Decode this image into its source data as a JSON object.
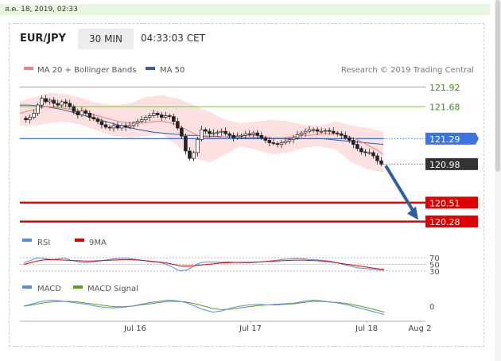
{
  "timestamp": "ส.ค. 18, 2019, 02:33",
  "header": {
    "symbol": "EUR/JPY",
    "timeframe": "30 MIN",
    "time": "04:33:03 CET"
  },
  "legend": {
    "ma20_bb": "MA 20 + Bollinger Bands",
    "ma50": "MA 50",
    "credit": "Research © 2019 Trading Central"
  },
  "colors": {
    "resistance": "#7ec341",
    "support": "#e00000",
    "pivot": "#3b74e0",
    "last": "#333333",
    "arrow": "#2f5f9e",
    "ma20": "#f08080",
    "ma50": "#3a5c9e",
    "bollinger": "#fcd6d6",
    "rsi": "#5b8be0",
    "rsi_ma": "#e00000",
    "macd": "#5b8be0",
    "macd_signal": "#5aa020"
  },
  "chart_data": [
    {
      "type": "candlestick",
      "title": "EUR/JPY 30 MIN",
      "x_labels": [
        "Jul 16",
        "Jul 17",
        "Jul 18",
        "Aug 2"
      ],
      "ylim": [
        120.15,
        122.05
      ],
      "levels": [
        {
          "name": "resistance-2",
          "value": 121.92,
          "label": "121.92",
          "color": "#7ec341"
        },
        {
          "name": "resistance-1",
          "value": 121.68,
          "label": "121.68",
          "color": "#7ec341"
        },
        {
          "name": "pivot",
          "value": 121.29,
          "label": "121.29",
          "color": "#3b74e0"
        },
        {
          "name": "last-price",
          "value": 120.98,
          "label": "120.98",
          "color": "#333333"
        },
        {
          "name": "support-1",
          "value": 120.51,
          "label": "120.51",
          "color": "#e00000"
        },
        {
          "name": "support-2",
          "value": 120.28,
          "label": "120.28",
          "color": "#e00000"
        }
      ],
      "close": [
        121.52,
        121.55,
        121.6,
        121.7,
        121.78,
        121.74,
        121.76,
        121.72,
        121.7,
        121.74,
        121.72,
        121.68,
        121.62,
        121.58,
        121.63,
        121.6,
        121.55,
        121.53,
        121.5,
        121.46,
        121.43,
        121.42,
        121.45,
        121.42,
        121.45,
        121.43,
        121.45,
        121.48,
        121.5,
        121.52,
        121.55,
        121.57,
        121.6,
        121.58,
        121.55,
        121.57,
        121.56,
        121.5,
        121.42,
        121.32,
        121.14,
        121.05,
        121.12,
        121.28,
        121.4,
        121.38,
        121.35,
        121.36,
        121.37,
        121.38,
        121.35,
        121.33,
        121.3,
        121.32,
        121.33,
        121.35,
        121.34,
        121.36,
        121.33,
        121.3,
        121.27,
        121.24,
        121.23,
        121.22,
        121.24,
        121.26,
        121.28,
        121.3,
        121.34,
        121.36,
        121.38,
        121.4,
        121.4,
        121.38,
        121.38,
        121.39,
        121.38,
        121.36,
        121.35,
        121.33,
        121.3,
        121.27,
        121.22,
        121.17,
        121.13,
        121.12,
        121.12,
        121.08,
        121.02,
        120.98
      ],
      "ma20": [
        121.6,
        121.62,
        121.64,
        121.66,
        121.68,
        121.68,
        121.67,
        121.66,
        121.65,
        121.64,
        121.62,
        121.6,
        121.58,
        121.56,
        121.54,
        121.52,
        121.5,
        121.49,
        121.48,
        121.48,
        121.48,
        121.49,
        121.5,
        121.5,
        121.49,
        121.47,
        121.44,
        121.4,
        121.36,
        121.33,
        121.31,
        121.3,
        121.3,
        121.31,
        121.32,
        121.33,
        121.33,
        121.33,
        121.33,
        121.32,
        121.31,
        121.3,
        121.3,
        121.3,
        121.31,
        121.32,
        121.33,
        121.33,
        121.34,
        121.35,
        121.35,
        121.35,
        121.34,
        121.33,
        121.3,
        121.27,
        121.23,
        121.19,
        121.15,
        121.1
      ],
      "ma50": [
        121.7,
        121.7,
        121.69,
        121.68,
        121.66,
        121.64,
        121.61,
        121.58,
        121.55,
        121.52,
        121.49,
        121.46,
        121.43,
        121.41,
        121.39,
        121.37,
        121.36,
        121.35,
        121.34,
        121.33,
        121.33,
        121.32,
        121.32,
        121.31,
        121.31,
        121.3,
        121.3,
        121.3,
        121.29,
        121.29,
        121.29,
        121.29,
        121.29,
        121.29,
        121.29,
        121.28,
        121.27,
        121.26,
        121.25,
        121.24,
        121.23,
        121.22
      ],
      "bb_upper": [
        121.75,
        121.8,
        121.85,
        121.83,
        121.78,
        121.72,
        121.7,
        121.72,
        121.8,
        121.82,
        121.78,
        121.7,
        121.62,
        121.52,
        121.48,
        121.5,
        121.52,
        121.5,
        121.46,
        121.45,
        121.5,
        121.45,
        121.42,
        121.38
      ],
      "bb_lower": [
        121.45,
        121.45,
        121.48,
        121.5,
        121.45,
        121.38,
        121.32,
        121.3,
        121.32,
        121.35,
        121.2,
        121.05,
        121.0,
        121.1,
        121.2,
        121.15,
        121.1,
        121.12,
        121.18,
        121.2,
        121.15,
        121.0,
        120.92,
        120.88
      ]
    },
    {
      "type": "line",
      "title": "RSI",
      "series": [
        {
          "name": "RSI"
        },
        {
          "name": "9MA"
        }
      ],
      "y_ticks": [
        70,
        50,
        30
      ],
      "ylim": [
        20,
        80
      ],
      "rsi": [
        55,
        62,
        70,
        68,
        64,
        66,
        69,
        62,
        58,
        55,
        57,
        60,
        63,
        66,
        68,
        70,
        66,
        64,
        60,
        58,
        56,
        50,
        40,
        30,
        33,
        45,
        55,
        58,
        57,
        56,
        58,
        56,
        55,
        54,
        56,
        58,
        60,
        62,
        65,
        66,
        68,
        67,
        65,
        64,
        62,
        60,
        55,
        50,
        45,
        40,
        38,
        36,
        34,
        32
      ],
      "rsi_ma": [
        50,
        55,
        60,
        64,
        65,
        64,
        63,
        62,
        61,
        60,
        60,
        61,
        62,
        63,
        64,
        65,
        64,
        63,
        61,
        59,
        57,
        54,
        50,
        46,
        45,
        46,
        48,
        50,
        52,
        54,
        55,
        56,
        56,
        56,
        57,
        58,
        59,
        60,
        61,
        62,
        63,
        63,
        62,
        61,
        60,
        58,
        55,
        52,
        49,
        46,
        43,
        40,
        37,
        35
      ]
    },
    {
      "type": "line",
      "title": "MACD",
      "series": [
        {
          "name": "MACD"
        },
        {
          "name": "MACD Signal"
        }
      ],
      "y_ticks": [
        0
      ],
      "ylim": [
        -0.2,
        0.2
      ],
      "macd": [
        0.0,
        0.04,
        0.08,
        0.1,
        0.09,
        0.07,
        0.05,
        0.03,
        0.0,
        -0.02,
        -0.03,
        -0.02,
        0.0,
        0.03,
        0.06,
        0.08,
        0.1,
        0.09,
        0.06,
        0.0,
        -0.06,
        -0.1,
        -0.08,
        -0.03,
        0.0,
        0.02,
        0.03,
        0.02,
        0.03,
        0.04,
        0.05,
        0.08,
        0.1,
        0.09,
        0.07,
        0.05,
        0.02,
        -0.02,
        -0.06,
        -0.1,
        -0.14
      ],
      "macd_signal": [
        0.0,
        0.02,
        0.05,
        0.07,
        0.08,
        0.08,
        0.07,
        0.05,
        0.03,
        0.01,
        -0.01,
        -0.01,
        0.0,
        0.02,
        0.04,
        0.06,
        0.08,
        0.08,
        0.07,
        0.04,
        0.0,
        -0.04,
        -0.06,
        -0.05,
        -0.03,
        -0.01,
        0.01,
        0.02,
        0.02,
        0.03,
        0.04,
        0.06,
        0.08,
        0.08,
        0.07,
        0.06,
        0.04,
        0.01,
        -0.02,
        -0.06,
        -0.1
      ]
    }
  ]
}
